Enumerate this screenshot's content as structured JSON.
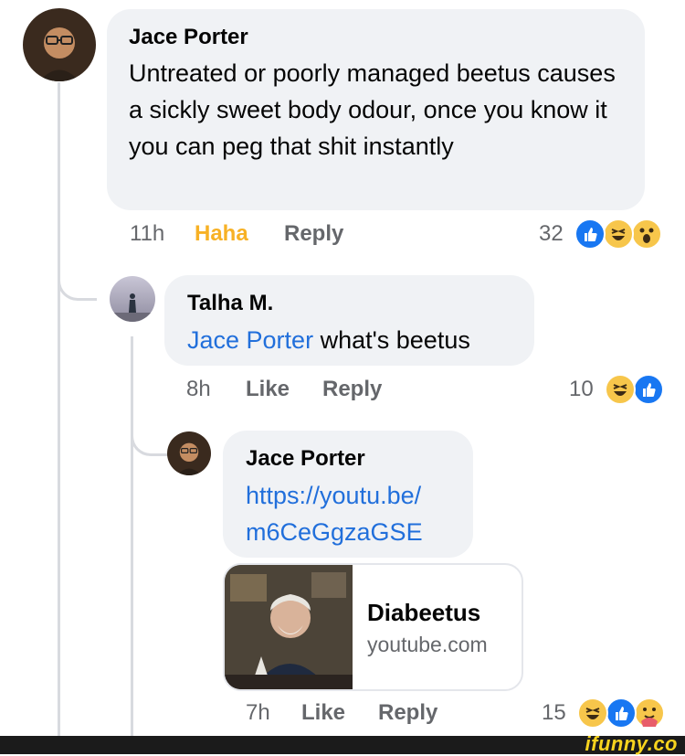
{
  "comment1": {
    "author": "Jace Porter",
    "text": "Untreated or poorly managed beetus causes a sickly sweet body odour, once you know it you can peg that shit instantly",
    "time": "11h",
    "reaction_action": "Haha",
    "reply_label": "Reply",
    "reaction_count": "32",
    "reaction_icons": [
      "like-icon",
      "haha-icon",
      "wow-icon"
    ]
  },
  "comment2": {
    "author": "Talha M.",
    "mention": "Jace Porter",
    "text": "what's beetus",
    "time": "8h",
    "like_label": "Like",
    "reply_label": "Reply",
    "reaction_count": "10",
    "reaction_icons": [
      "haha-icon",
      "like-icon"
    ]
  },
  "comment3": {
    "author": "Jace Porter",
    "link_line1": "https://youtu.be/",
    "link_line2": "m6CeGgzaGSE",
    "preview_title": "Diabeetus",
    "preview_domain": "youtube.com",
    "time": "7h",
    "like_label": "Like",
    "reply_label": "Reply",
    "reaction_count": "15",
    "reaction_icons": [
      "haha-icon",
      "like-icon",
      "care-icon"
    ]
  },
  "footer": {
    "watermark": "ifunny.co"
  },
  "colors": {
    "link": "#216fdb",
    "haha_text": "#f7b125",
    "bubble": "#f0f2f5",
    "meta": "#65676b"
  }
}
